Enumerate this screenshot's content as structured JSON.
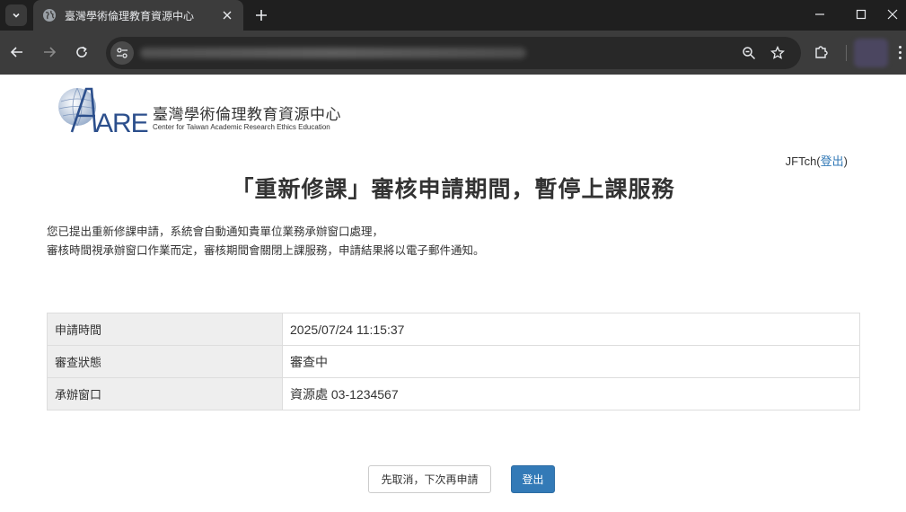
{
  "browser": {
    "tab_title": "臺灣學術倫理教育資源中心",
    "new_tab_icon": "plus-icon",
    "colors": {
      "tabstrip": "#1f1f1f",
      "toolbar": "#3c3c3c",
      "omnibox": "#282828"
    }
  },
  "logo": {
    "mark": "AREE",
    "name_cn": "臺灣學術倫理教育資源中心",
    "name_en": "Center for Taiwan Academic Research Ethics Education"
  },
  "user": {
    "name": "JFTch",
    "open_paren": "(",
    "logout_link": "登出",
    "close_paren": ")"
  },
  "headline": "「重新修課」審核申請期間，暫停上課服務",
  "notice": [
    "您已提出重新修課申請，系統會自動通知貴單位業務承辦窗口處理，",
    "審核時間視承辦窗口作業而定，審核期間會關閉上課服務，申請結果將以電子郵件通知。"
  ],
  "table": [
    {
      "label": "申請時間",
      "value": "2025/07/24 11:15:37"
    },
    {
      "label": "審查狀態",
      "value": "審查中"
    },
    {
      "label": "承辦窗口",
      "value": "資源處 03-1234567"
    }
  ],
  "buttons": {
    "cancel": "先取消，下次再申請",
    "logout": "登出"
  },
  "colors": {
    "primary": "#337ab7",
    "text": "#333333",
    "label_bg": "#eeeeee",
    "border": "#dddddd"
  }
}
